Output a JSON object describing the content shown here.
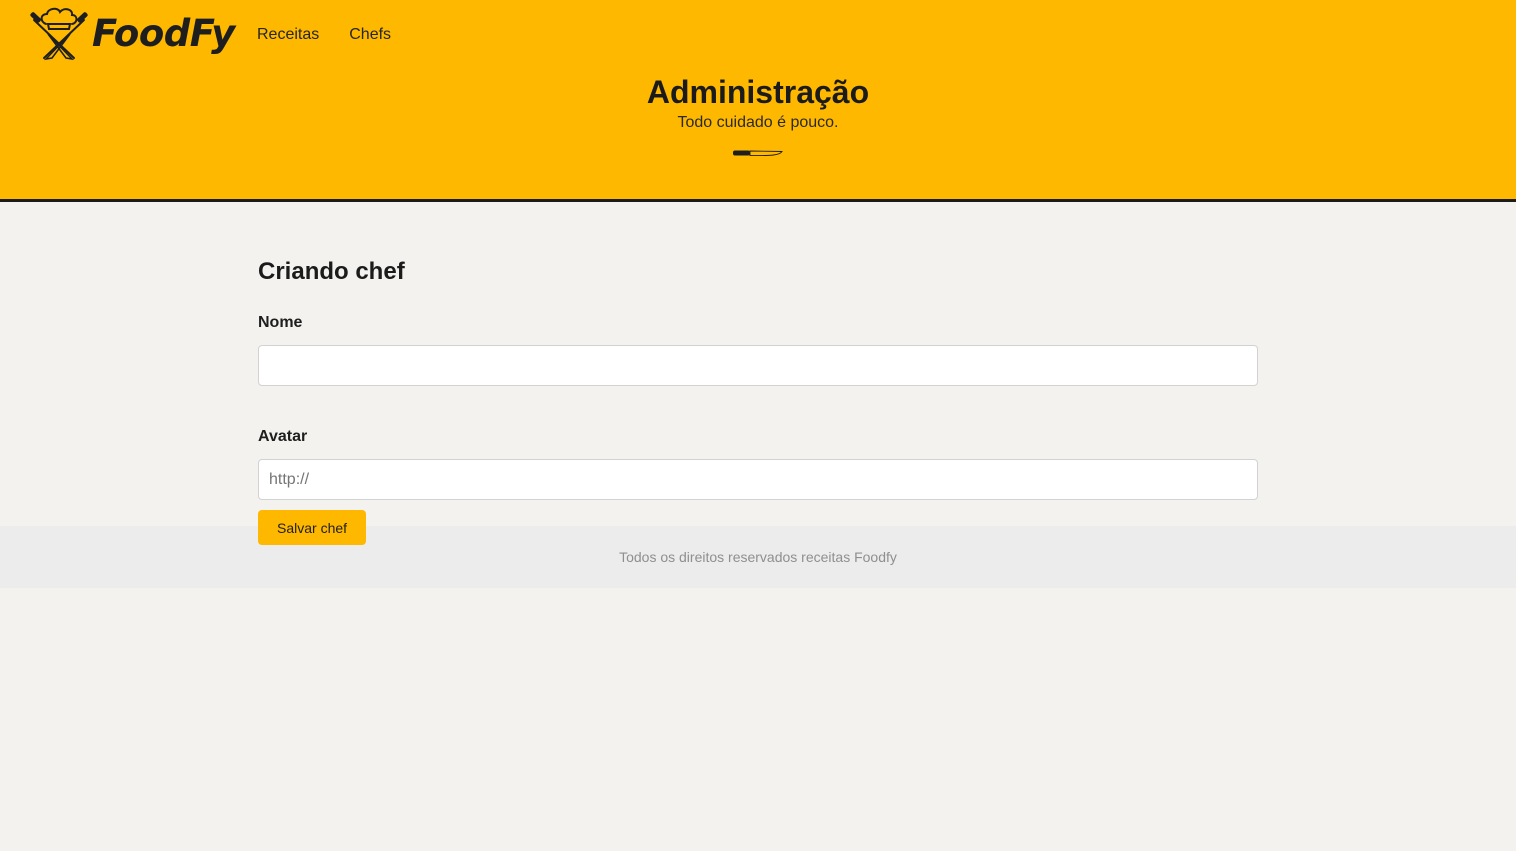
{
  "header": {
    "brand": "FoodFy",
    "nav": [
      {
        "label": "Receitas"
      },
      {
        "label": "Chefs"
      }
    ],
    "title": "Administração",
    "subtitle": "Todo cuidado é pouco.",
    "colors": {
      "accent": "#ffb800",
      "border": "#1c1c1c"
    }
  },
  "main": {
    "heading": "Criando chef",
    "fields": [
      {
        "label": "Nome",
        "value": "",
        "placeholder": ""
      },
      {
        "label": "Avatar",
        "value": "",
        "placeholder": "http://"
      }
    ],
    "submit_label": "Salvar chef"
  },
  "footer": {
    "text": "Todos os direitos reservados receitas Foodfy"
  },
  "icons": {
    "logo": "chef-hat-crossed-knives-icon",
    "divider": "knife-icon"
  }
}
